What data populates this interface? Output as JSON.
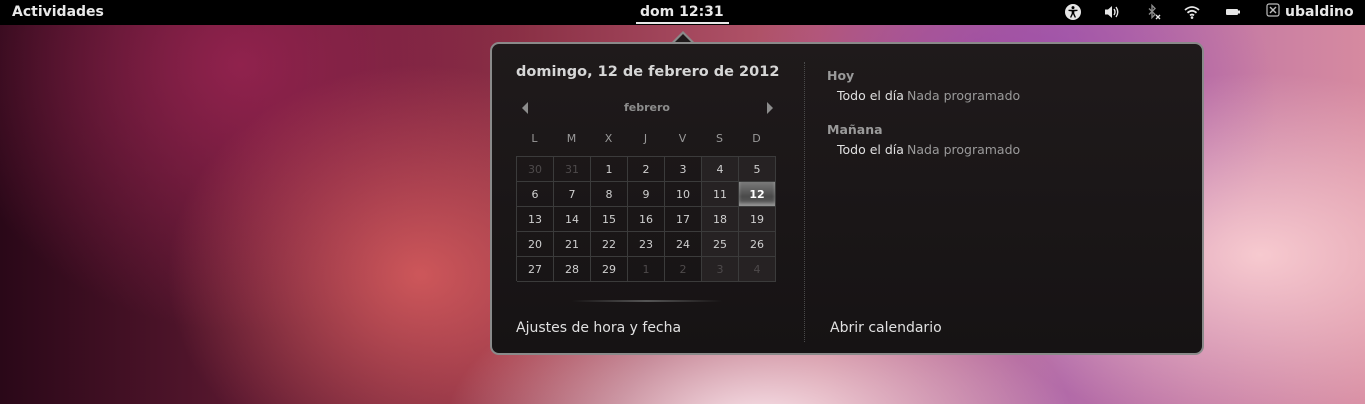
{
  "top_panel": {
    "activities_label": "Actividades",
    "clock": "dom 12:31",
    "user_name": "ubaldino",
    "tray_icons": [
      "accessibility-icon",
      "volume-icon",
      "bluetooth-disabled-icon",
      "wifi-icon",
      "battery-icon",
      "user-status-icon"
    ]
  },
  "calendar": {
    "date_heading": "domingo, 12 de febrero de 2012",
    "month_name": "febrero",
    "weekdays": [
      "L",
      "M",
      "X",
      "J",
      "V",
      "S",
      "D"
    ],
    "weeks": [
      [
        "30",
        "31",
        "1",
        "2",
        "3",
        "4",
        "5"
      ],
      [
        "6",
        "7",
        "8",
        "9",
        "10",
        "11",
        "12"
      ],
      [
        "13",
        "14",
        "15",
        "16",
        "17",
        "18",
        "19"
      ],
      [
        "20",
        "21",
        "22",
        "23",
        "24",
        "25",
        "26"
      ],
      [
        "27",
        "28",
        "29",
        "1",
        "2",
        "3",
        "4"
      ]
    ],
    "other_month_days": [
      [
        0,
        0
      ],
      [
        0,
        1
      ],
      [
        4,
        3
      ],
      [
        4,
        4
      ],
      [
        4,
        5
      ],
      [
        4,
        6
      ]
    ],
    "today": [
      1,
      6
    ],
    "settings_label": "Ajustes de hora y fecha"
  },
  "events": {
    "sections": [
      {
        "title": "Hoy",
        "time": "Todo el día",
        "description": "Nada programado"
      },
      {
        "title": "Mañana",
        "time": "Todo el día",
        "description": "Nada programado"
      }
    ],
    "open_calendar_label": "Abrir calendario"
  },
  "colors": {
    "panel_background": "#000000",
    "popup_background": "#1f1a1b",
    "popup_border": "#8a8a8a",
    "today_highlight": "#6a6a6a"
  }
}
